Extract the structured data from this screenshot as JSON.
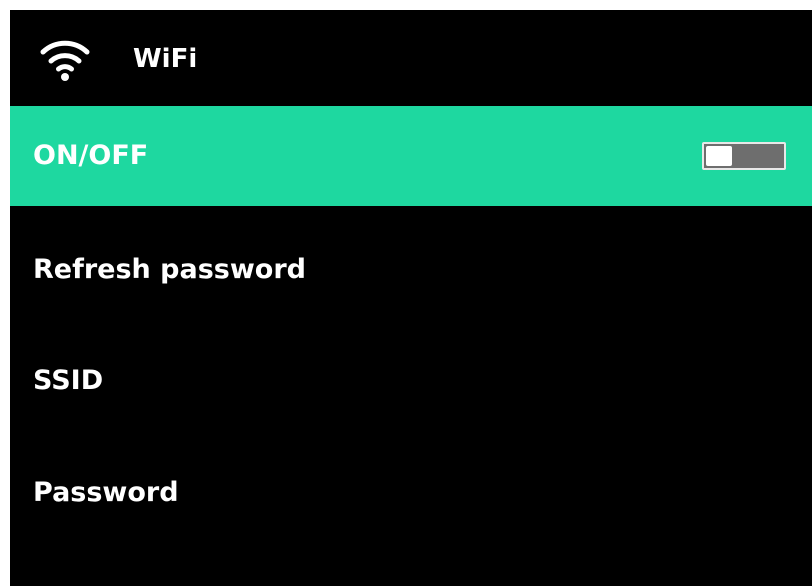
{
  "header": {
    "icon": "wifi-icon",
    "title": "WiFi"
  },
  "colors": {
    "background": "#000000",
    "selected": "#1ed8a0",
    "text": "#ffffff",
    "toggle_track": "#6e6e6e"
  },
  "menu": {
    "items": [
      {
        "label": "ON/OFF",
        "selected": true,
        "toggle_on": false
      },
      {
        "label": "Refresh password",
        "selected": false
      },
      {
        "label": "SSID",
        "selected": false
      },
      {
        "label": "Password",
        "selected": false
      }
    ]
  }
}
